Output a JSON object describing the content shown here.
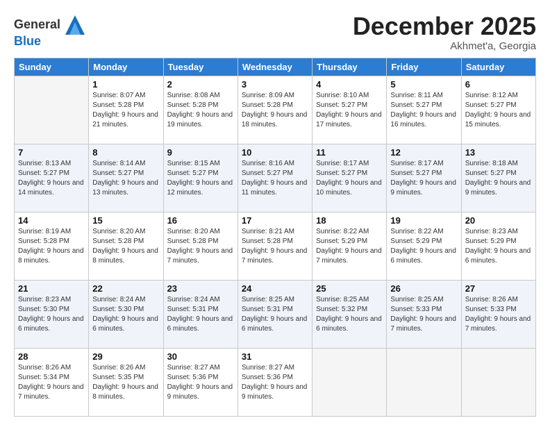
{
  "logo": {
    "general": "General",
    "blue": "Blue"
  },
  "header": {
    "month": "December 2025",
    "location": "Akhmet'a, Georgia"
  },
  "weekdays": [
    "Sunday",
    "Monday",
    "Tuesday",
    "Wednesday",
    "Thursday",
    "Friday",
    "Saturday"
  ],
  "weeks": [
    [
      {
        "day": "",
        "sunrise": "",
        "sunset": "",
        "daylight": ""
      },
      {
        "day": "1",
        "sunrise": "Sunrise: 8:07 AM",
        "sunset": "Sunset: 5:28 PM",
        "daylight": "Daylight: 9 hours and 21 minutes."
      },
      {
        "day": "2",
        "sunrise": "Sunrise: 8:08 AM",
        "sunset": "Sunset: 5:28 PM",
        "daylight": "Daylight: 9 hours and 19 minutes."
      },
      {
        "day": "3",
        "sunrise": "Sunrise: 8:09 AM",
        "sunset": "Sunset: 5:28 PM",
        "daylight": "Daylight: 9 hours and 18 minutes."
      },
      {
        "day": "4",
        "sunrise": "Sunrise: 8:10 AM",
        "sunset": "Sunset: 5:27 PM",
        "daylight": "Daylight: 9 hours and 17 minutes."
      },
      {
        "day": "5",
        "sunrise": "Sunrise: 8:11 AM",
        "sunset": "Sunset: 5:27 PM",
        "daylight": "Daylight: 9 hours and 16 minutes."
      },
      {
        "day": "6",
        "sunrise": "Sunrise: 8:12 AM",
        "sunset": "Sunset: 5:27 PM",
        "daylight": "Daylight: 9 hours and 15 minutes."
      }
    ],
    [
      {
        "day": "7",
        "sunrise": "Sunrise: 8:13 AM",
        "sunset": "Sunset: 5:27 PM",
        "daylight": "Daylight: 9 hours and 14 minutes."
      },
      {
        "day": "8",
        "sunrise": "Sunrise: 8:14 AM",
        "sunset": "Sunset: 5:27 PM",
        "daylight": "Daylight: 9 hours and 13 minutes."
      },
      {
        "day": "9",
        "sunrise": "Sunrise: 8:15 AM",
        "sunset": "Sunset: 5:27 PM",
        "daylight": "Daylight: 9 hours and 12 minutes."
      },
      {
        "day": "10",
        "sunrise": "Sunrise: 8:16 AM",
        "sunset": "Sunset: 5:27 PM",
        "daylight": "Daylight: 9 hours and 11 minutes."
      },
      {
        "day": "11",
        "sunrise": "Sunrise: 8:17 AM",
        "sunset": "Sunset: 5:27 PM",
        "daylight": "Daylight: 9 hours and 10 minutes."
      },
      {
        "day": "12",
        "sunrise": "Sunrise: 8:17 AM",
        "sunset": "Sunset: 5:27 PM",
        "daylight": "Daylight: 9 hours and 9 minutes."
      },
      {
        "day": "13",
        "sunrise": "Sunrise: 8:18 AM",
        "sunset": "Sunset: 5:27 PM",
        "daylight": "Daylight: 9 hours and 9 minutes."
      }
    ],
    [
      {
        "day": "14",
        "sunrise": "Sunrise: 8:19 AM",
        "sunset": "Sunset: 5:28 PM",
        "daylight": "Daylight: 9 hours and 8 minutes."
      },
      {
        "day": "15",
        "sunrise": "Sunrise: 8:20 AM",
        "sunset": "Sunset: 5:28 PM",
        "daylight": "Daylight: 9 hours and 8 minutes."
      },
      {
        "day": "16",
        "sunrise": "Sunrise: 8:20 AM",
        "sunset": "Sunset: 5:28 PM",
        "daylight": "Daylight: 9 hours and 7 minutes."
      },
      {
        "day": "17",
        "sunrise": "Sunrise: 8:21 AM",
        "sunset": "Sunset: 5:28 PM",
        "daylight": "Daylight: 9 hours and 7 minutes."
      },
      {
        "day": "18",
        "sunrise": "Sunrise: 8:22 AM",
        "sunset": "Sunset: 5:29 PM",
        "daylight": "Daylight: 9 hours and 7 minutes."
      },
      {
        "day": "19",
        "sunrise": "Sunrise: 8:22 AM",
        "sunset": "Sunset: 5:29 PM",
        "daylight": "Daylight: 9 hours and 6 minutes."
      },
      {
        "day": "20",
        "sunrise": "Sunrise: 8:23 AM",
        "sunset": "Sunset: 5:29 PM",
        "daylight": "Daylight: 9 hours and 6 minutes."
      }
    ],
    [
      {
        "day": "21",
        "sunrise": "Sunrise: 8:23 AM",
        "sunset": "Sunset: 5:30 PM",
        "daylight": "Daylight: 9 hours and 6 minutes."
      },
      {
        "day": "22",
        "sunrise": "Sunrise: 8:24 AM",
        "sunset": "Sunset: 5:30 PM",
        "daylight": "Daylight: 9 hours and 6 minutes."
      },
      {
        "day": "23",
        "sunrise": "Sunrise: 8:24 AM",
        "sunset": "Sunset: 5:31 PM",
        "daylight": "Daylight: 9 hours and 6 minutes."
      },
      {
        "day": "24",
        "sunrise": "Sunrise: 8:25 AM",
        "sunset": "Sunset: 5:31 PM",
        "daylight": "Daylight: 9 hours and 6 minutes."
      },
      {
        "day": "25",
        "sunrise": "Sunrise: 8:25 AM",
        "sunset": "Sunset: 5:32 PM",
        "daylight": "Daylight: 9 hours and 6 minutes."
      },
      {
        "day": "26",
        "sunrise": "Sunrise: 8:25 AM",
        "sunset": "Sunset: 5:33 PM",
        "daylight": "Daylight: 9 hours and 7 minutes."
      },
      {
        "day": "27",
        "sunrise": "Sunrise: 8:26 AM",
        "sunset": "Sunset: 5:33 PM",
        "daylight": "Daylight: 9 hours and 7 minutes."
      }
    ],
    [
      {
        "day": "28",
        "sunrise": "Sunrise: 8:26 AM",
        "sunset": "Sunset: 5:34 PM",
        "daylight": "Daylight: 9 hours and 7 minutes."
      },
      {
        "day": "29",
        "sunrise": "Sunrise: 8:26 AM",
        "sunset": "Sunset: 5:35 PM",
        "daylight": "Daylight: 9 hours and 8 minutes."
      },
      {
        "day": "30",
        "sunrise": "Sunrise: 8:27 AM",
        "sunset": "Sunset: 5:36 PM",
        "daylight": "Daylight: 9 hours and 9 minutes."
      },
      {
        "day": "31",
        "sunrise": "Sunrise: 8:27 AM",
        "sunset": "Sunset: 5:36 PM",
        "daylight": "Daylight: 9 hours and 9 minutes."
      },
      {
        "day": "",
        "sunrise": "",
        "sunset": "",
        "daylight": ""
      },
      {
        "day": "",
        "sunrise": "",
        "sunset": "",
        "daylight": ""
      },
      {
        "day": "",
        "sunrise": "",
        "sunset": "",
        "daylight": ""
      }
    ]
  ]
}
